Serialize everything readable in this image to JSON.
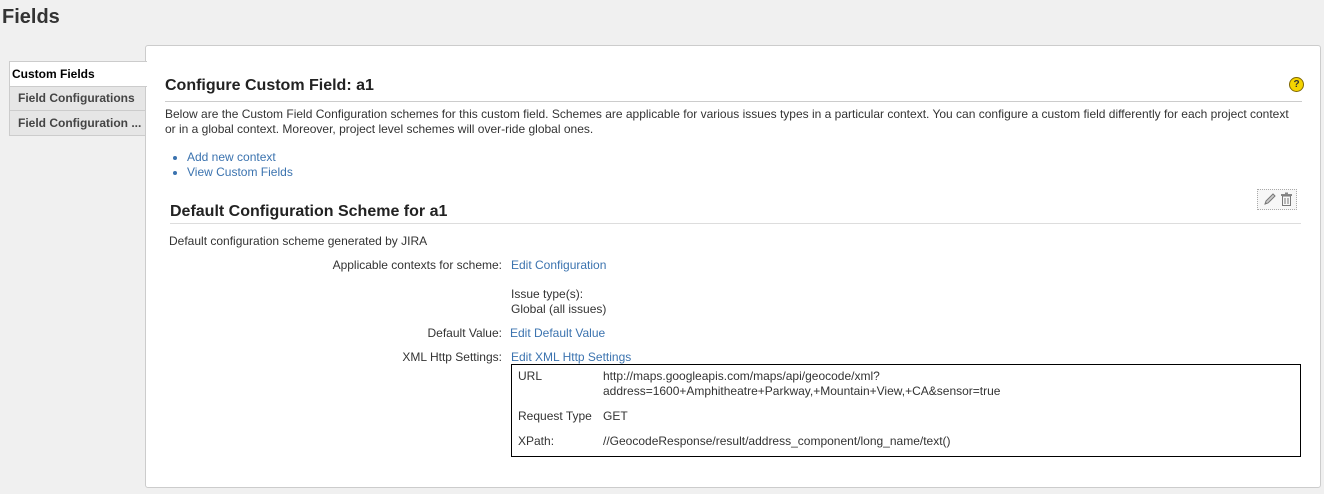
{
  "page": {
    "title": "Fields"
  },
  "tabs": [
    {
      "label": "Custom Fields",
      "active": true
    },
    {
      "label": "Field Configurations",
      "active": false
    },
    {
      "label": "Field Configuration ...",
      "active": false
    }
  ],
  "config": {
    "title": "Configure Custom Field: a1",
    "help_icon": "?",
    "description": "Below are the Custom Field Configuration schemes for this custom field. Schemes are applicable for various issues types in a particular context. You can configure a custom field differently for each project context or in a global context. Moreover, project level schemes will over-ride global ones.",
    "links": [
      "Add new context",
      "View Custom Fields"
    ]
  },
  "scheme": {
    "title": "Default Configuration Scheme for a1",
    "description": "Default configuration scheme generated by JIRA",
    "contexts_label": "Applicable contexts for scheme:",
    "edit_configuration": "Edit Configuration",
    "issue_types_label": "Issue type(s):",
    "issue_types_value": "Global (all issues)",
    "default_value_label": "Default Value:",
    "edit_default_value": "Edit Default Value",
    "xml_label": "XML Http Settings:",
    "edit_xml": "Edit XML Http Settings",
    "xml": {
      "url_key": "URL",
      "url_line1": "http://maps.googleapis.com/maps/api/geocode/xml?",
      "url_line2": "address=1600+Amphitheatre+Parkway,+Mountain+View,+CA&sensor=true",
      "request_type_key": "Request Type",
      "request_type_value": "GET",
      "xpath_key": "XPath:",
      "xpath_value": "//GeocodeResponse/result/address_component/long_name/text()"
    }
  },
  "icons": {
    "edit": "edit-icon",
    "delete": "trash-icon"
  }
}
